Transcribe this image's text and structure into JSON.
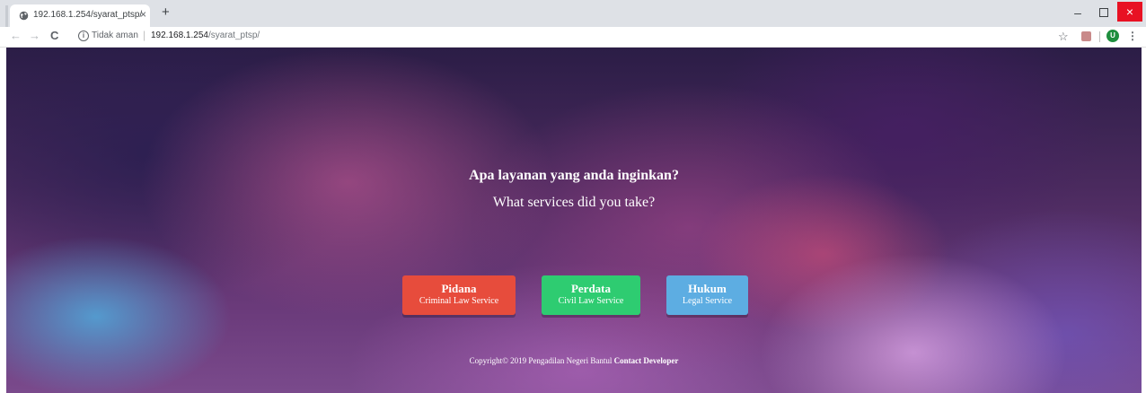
{
  "browser": {
    "tab": {
      "title": "192.168.1.254/syarat_ptsp/",
      "close_glyph": "×",
      "favicon": "globe-icon"
    },
    "new_tab_glyph": "+",
    "window_controls": {
      "minimize_glyph": "–",
      "close_glyph": "×",
      "close_color": "#e81123"
    },
    "nav": {
      "back_glyph": "←",
      "forward_glyph": "→",
      "reload_glyph": "C"
    },
    "address": {
      "security_label": "Tidak aman",
      "info_glyph": "i",
      "separator": "|",
      "host": "192.168.1.254",
      "path": "/syarat_ptsp/"
    },
    "toolbar": {
      "bookmark_glyph": "☆",
      "avatar_letter": "U",
      "menu_glyph": "⋮"
    }
  },
  "page": {
    "heading": "Apa layanan yang anda inginkan?",
    "subheading": "What services did you take?",
    "services": [
      {
        "title": "Pidana",
        "subtitle": "Criminal Law Service",
        "color": "#e74c3c"
      },
      {
        "title": "Perdata",
        "subtitle": "Civil Law Service",
        "color": "#2ecc71"
      },
      {
        "title": "Hukum",
        "subtitle": "Legal Service",
        "color": "#5dade2"
      }
    ],
    "footer": {
      "copyright": "Copyright© 2019 Pengadilan Negeri Bantul",
      "link": "Contact Developer"
    }
  }
}
